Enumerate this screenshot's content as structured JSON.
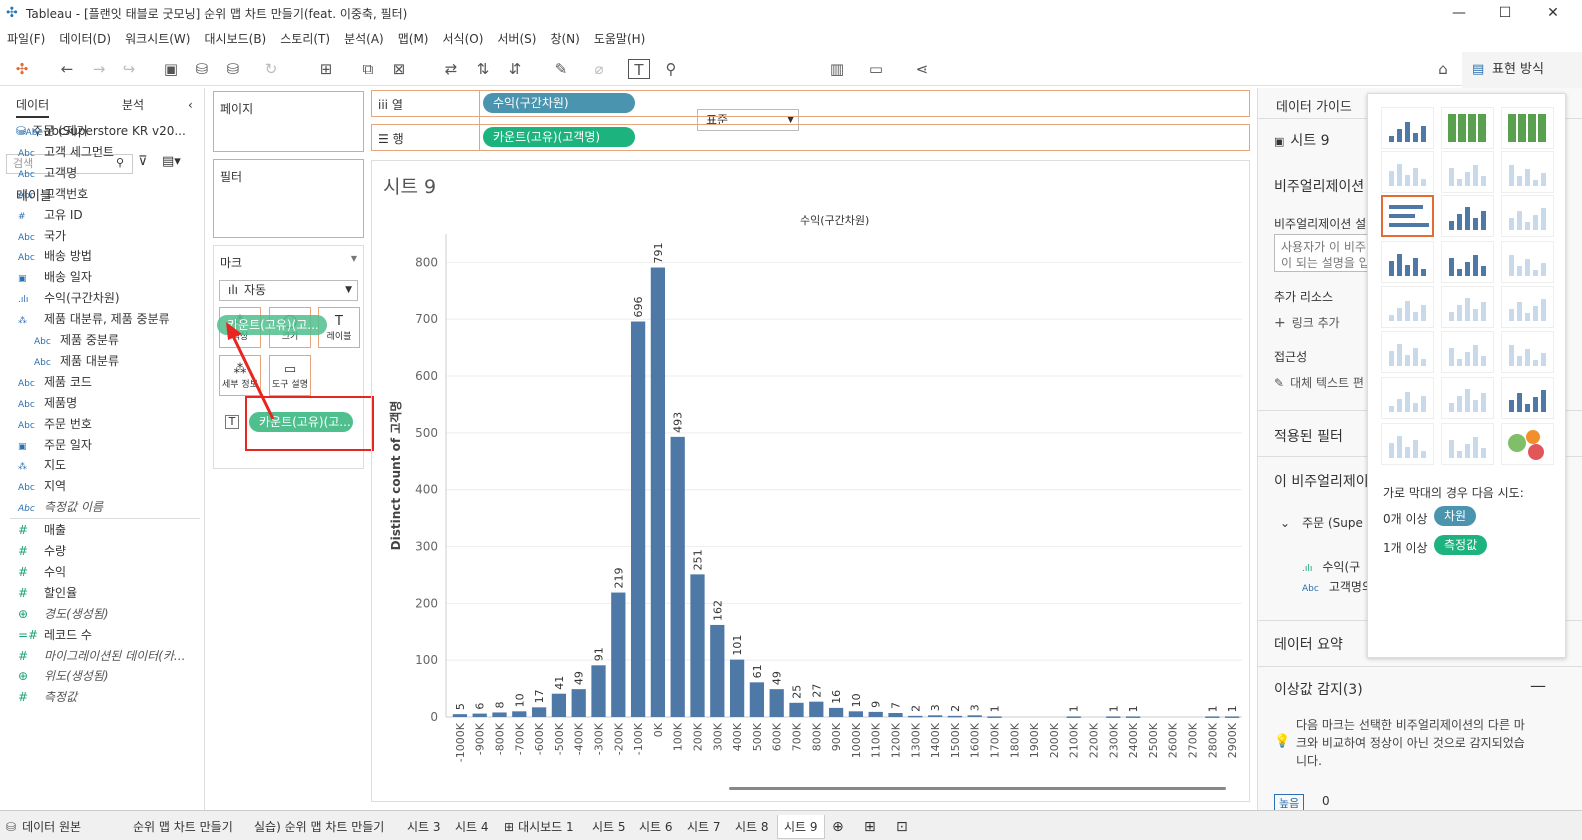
{
  "window": {
    "title": "Tableau - [플랜잇 태블로 굿모닝] 순위 맵 차트 만들기(feat. 이중축, 필터)",
    "minimize": "—",
    "maximize": "☐",
    "close": "✕"
  },
  "menu": [
    "파일(F)",
    "데이터(D)",
    "워크시트(W)",
    "대시보드(B)",
    "스토리(T)",
    "분석(A)",
    "맵(M)",
    "서식(O)",
    "서버(S)",
    "창(N)",
    "도움말(H)"
  ],
  "toolbar": {
    "style_select": "표준",
    "show_me": "표현 방식"
  },
  "left": {
    "tab_data": "데이터",
    "tab_analytics": "분석",
    "datasource": "주문 (Superstore KR v20...",
    "search_placeholder": "검색",
    "tables_header": "테이블",
    "fields": [
      {
        "icon": "=Abc",
        "name": "abc제거"
      },
      {
        "icon": "Abc",
        "name": "고객 세그먼트"
      },
      {
        "icon": "Abc",
        "name": "고객명"
      },
      {
        "icon": "Abc",
        "name": "고객번호"
      },
      {
        "icon": "#",
        "name": "고유 ID"
      },
      {
        "icon": "Abc",
        "name": "국가"
      },
      {
        "icon": "Abc",
        "name": "배송 방법"
      },
      {
        "icon": "cal",
        "name": "배송 일자"
      },
      {
        "icon": "bar",
        "name": "수익(구간차원)"
      },
      {
        "icon": "hier",
        "name": "제품 대분류, 제품 중분류"
      },
      {
        "icon": "Abc",
        "name": "제품 중분류"
      },
      {
        "icon": "Abc",
        "name": "제품 대분류"
      },
      {
        "icon": "Abc",
        "name": "제품 코드"
      },
      {
        "icon": "Abc",
        "name": "제품명"
      },
      {
        "icon": "Abc",
        "name": "주문 번호"
      },
      {
        "icon": "cal",
        "name": "주문 일자"
      },
      {
        "icon": "hier",
        "name": "지도"
      },
      {
        "icon": "Abc",
        "name": "지역"
      },
      {
        "icon": "Abc",
        "name": "측정값 이름"
      }
    ],
    "measures": [
      {
        "icon": "#",
        "name": "매출"
      },
      {
        "icon": "#",
        "name": "수량"
      },
      {
        "icon": "#",
        "name": "수익"
      },
      {
        "icon": "#",
        "name": "할인율"
      },
      {
        "icon": "globe",
        "name": "경도(생성됨)"
      },
      {
        "icon": "=#",
        "name": "레코드 수"
      },
      {
        "icon": "#",
        "name": "마이그레이션된 데이터(카..."
      },
      {
        "icon": "globe",
        "name": "위도(생성됨)"
      },
      {
        "icon": "#",
        "name": "측정값"
      }
    ]
  },
  "cards": {
    "pages": "페이지",
    "filters": "필터",
    "marks": "마크",
    "marks_type": "자동",
    "color": "색상",
    "size": "크기",
    "label": "레이블",
    "detail": "세부 정보",
    "tooltip": "도구 설명",
    "dragging_pill": "카운트(고유)(고...",
    "label_pill": "카운트(고유)(고..."
  },
  "shelves": {
    "columns_label": "열",
    "columns_pill": "수익(구간차원)",
    "rows_label": "행",
    "rows_pill": "카운트(고유)(고객명)"
  },
  "sheet_title": "시트 9",
  "chart_data": {
    "type": "bar",
    "title": "수익(구간차원)",
    "ylabel": "Distinct count of 고객명",
    "xlabel": "",
    "ylim": [
      0,
      850
    ],
    "yticks": [
      0,
      100,
      200,
      300,
      400,
      500,
      600,
      700,
      800
    ],
    "categories": [
      "-1000K",
      "-900K",
      "-800K",
      "-700K",
      "-600K",
      "-500K",
      "-400K",
      "-300K",
      "-200K",
      "-100K",
      "0K",
      "100K",
      "200K",
      "300K",
      "400K",
      "500K",
      "600K",
      "700K",
      "800K",
      "900K",
      "1000K",
      "1100K",
      "1200K",
      "1300K",
      "1400K",
      "1500K",
      "1600K",
      "1700K",
      "1800K",
      "1900K",
      "2000K",
      "2100K",
      "2200K",
      "2300K",
      "2400K",
      "2500K",
      "2600K",
      "2700K",
      "2800K",
      "2900K"
    ],
    "values": [
      5,
      6,
      8,
      10,
      17,
      41,
      49,
      91,
      219,
      696,
      791,
      493,
      251,
      162,
      101,
      61,
      49,
      25,
      27,
      16,
      10,
      9,
      7,
      2,
      3,
      2,
      3,
      1,
      0,
      0,
      0,
      1,
      0,
      1,
      1,
      0,
      0,
      0,
      1,
      1
    ],
    "bar_color": "#4e79a7",
    "grid": true
  },
  "guide": {
    "header": "데이터 가이드",
    "sheet": "시트 9",
    "viz_section": "비주얼리제이션",
    "viz_desc_label": "비주얼리제이션 설",
    "viz_desc_ph1": "사용자가 이 비주",
    "viz_desc_ph2": "이 되는 설명을 입",
    "extra_resources": "추가 리소스",
    "add_link": "링크 추가",
    "accessibility": "접근성",
    "alt_text": "대체 텍스트 편",
    "applied_filters": "적용된 필터",
    "this_viz": "이 비주얼리제이",
    "source": "주문 (Supe",
    "field1": "수익(구",
    "field2": "고객명의",
    "data_summary": "데이터 요약",
    "outliers": "이상값 감지(3)",
    "outlier_desc1": "다음 마크는 선택한 비주얼리제이션의 다른 마",
    "outlier_desc2": "크와 비교하여 정상이 아닌 것으로 감지되었습",
    "outlier_desc3": "니다.",
    "high_badge": "높음",
    "high_value": "0"
  },
  "showme": {
    "hint": "가로 막대의 경우 다음 시도:",
    "dim_line": "0개 이상",
    "dim_badge": "차원",
    "meas_line": "1개 이상",
    "meas_badge": "측정값"
  },
  "bottom_tabs": [
    "데이터 원본",
    "순위 맵 차트 만들기",
    "실습) 순위 맵 차트 만들기",
    "시트 3",
    "시트 4",
    "대시보드 1",
    "시트 5",
    "시트 6",
    "시트 7",
    "시트 8",
    "시트 9"
  ]
}
